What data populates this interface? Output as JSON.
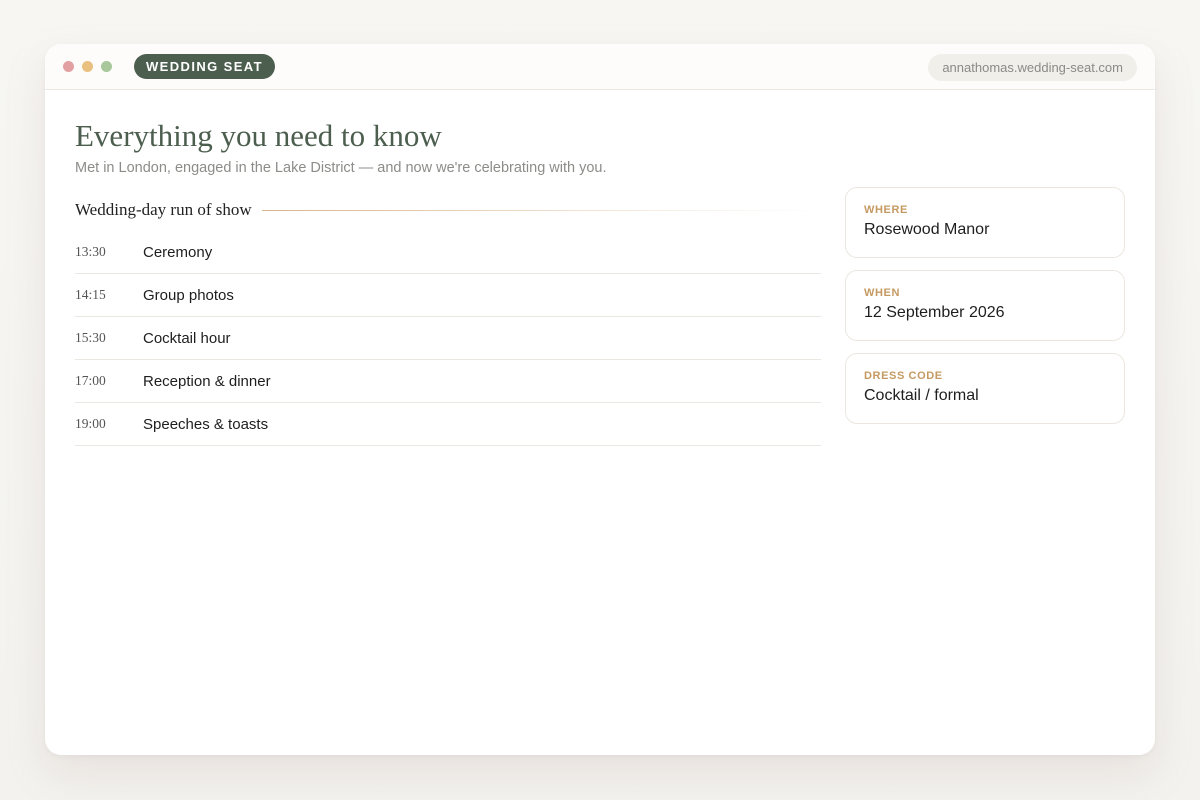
{
  "window": {
    "brand": "WEDDING SEAT",
    "url": "annathomas.wedding-seat.com"
  },
  "page": {
    "title": "Everything you need to know",
    "subtitle": "Met in London, engaged in the Lake District — and now we're celebrating with you."
  },
  "schedule": {
    "title": "Wedding-day run of show",
    "items": [
      {
        "time": "13:30",
        "event": "Ceremony"
      },
      {
        "time": "14:15",
        "event": "Group photos"
      },
      {
        "time": "15:30",
        "event": "Cocktail hour"
      },
      {
        "time": "17:00",
        "event": "Reception & dinner"
      },
      {
        "time": "19:00",
        "event": "Speeches & toasts"
      }
    ]
  },
  "details": [
    {
      "label": "WHERE",
      "value": "Rosewood Manor"
    },
    {
      "label": "WHEN",
      "value": "12 September 2026"
    },
    {
      "label": "DRESS CODE",
      "value": "Cocktail / formal"
    }
  ],
  "colors": {
    "brand": "#4c5e4e",
    "accent": "#c59a62",
    "dot_red": "#e2a0a3",
    "dot_yellow": "#e9c07f",
    "dot_green": "#a8c79b"
  }
}
